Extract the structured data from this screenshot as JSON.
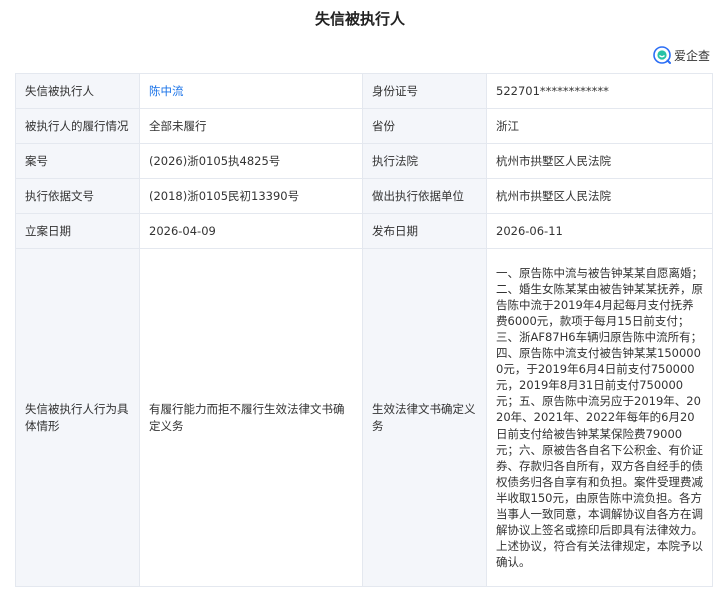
{
  "page_title": "失信被执行人",
  "brand": {
    "name": "爱企查",
    "icon": "aiqicha-logo-icon"
  },
  "colors": {
    "label_bg": "#f4f6fa",
    "border": "#e4e8ef",
    "link": "#1a73e8"
  },
  "rows": [
    {
      "label1": "失信被执行人",
      "value1": "陈中流",
      "label2": "身份证号",
      "value2": "522701************"
    },
    {
      "label1": "被执行人的履行情况",
      "value1": "全部未履行",
      "label2": "省份",
      "value2": "浙江"
    },
    {
      "label1": "案号",
      "value1": "(2026)浙0105执4825号",
      "label2": "执行法院",
      "value2": "杭州市拱墅区人民法院"
    },
    {
      "label1": "执行依据文号",
      "value1": "(2018)浙0105民初13390号",
      "label2": "做出执行依据单位",
      "value2": "杭州市拱墅区人民法院"
    },
    {
      "label1": "立案日期",
      "value1": "2026-04-09",
      "label2": "发布日期",
      "value2": "2026-06-11"
    },
    {
      "label1": "失信被执行人行为具体情形",
      "value1": "有履行能力而拒不履行生效法律文书确定义务",
      "label2": "生效法律文书确定义务",
      "value2": "一、原告陈中流与被告钟某某自愿离婚；二、婚生女陈某某由被告钟某某抚养，原告陈中流于2019年4月起每月支付抚养费6000元，款项于每月15日前支付；三、浙AF87H6车辆归原告陈中流所有；四、原告陈中流支付被告钟某某1500000元，于2019年6月4日前支付750000元，2019年8月31日前支付750000元；五、原告陈中流另应于2019年、2020年、2021年、2022年每年的6月20日前支付给被告钟某某保险费79000元；六、原被告各自名下公积金、有价证券、存款归各自所有，双方各自经手的债权债务归各自享有和负担。案件受理费减半收取150元，由原告陈中流负担。各方当事人一致同意，本调解协议自各方在调解协议上签名或捺印后即具有法律效力。上述协议，符合有关法律规定，本院予以确认。"
    }
  ]
}
